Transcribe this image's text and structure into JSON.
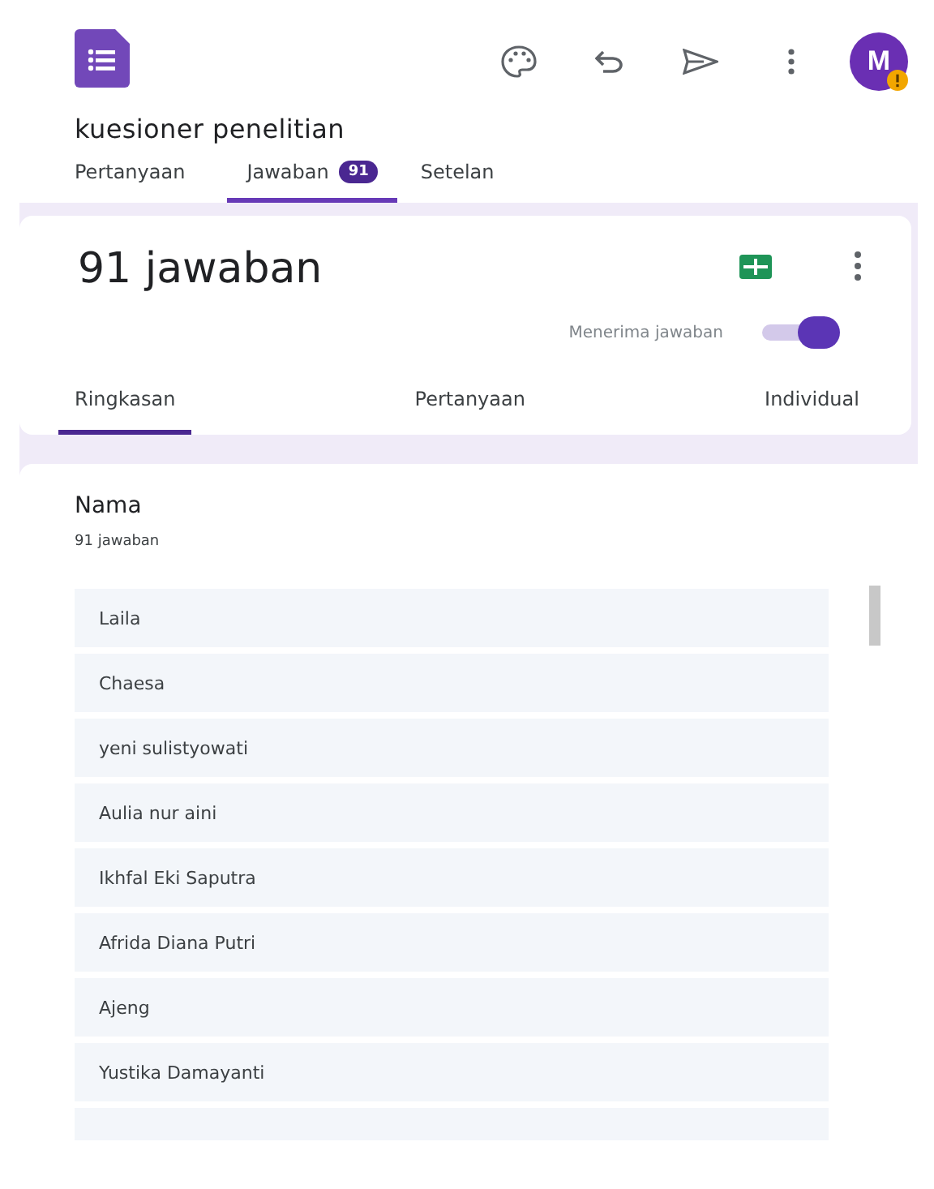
{
  "app_bar": {
    "avatar_letter": "M",
    "avatar_warning": true
  },
  "form_title": "kuesioner penelitian",
  "tabs": [
    {
      "label": "Pertanyaan",
      "selected": false
    },
    {
      "label": "Jawaban",
      "selected": true,
      "badge": "91"
    },
    {
      "label": "Setelan",
      "selected": false
    }
  ],
  "summary": {
    "title": "91 jawaban",
    "accepting_label": "Menerima jawaban",
    "accepting": true
  },
  "sub_tabs": [
    {
      "label": "Ringkasan",
      "selected": true
    },
    {
      "label": "Pertanyaan",
      "selected": false
    },
    {
      "label": "Individual",
      "selected": false
    }
  ],
  "question": {
    "title": "Nama",
    "count": "91 jawaban",
    "answers": [
      "Laila",
      "Chaesa",
      "yeni sulistyowati",
      "Aulia nur aini",
      "Ikhfal Eki Saputra",
      "Afrida Diana Putri",
      "Ajeng",
      "Yustika Damayanti"
    ]
  }
}
